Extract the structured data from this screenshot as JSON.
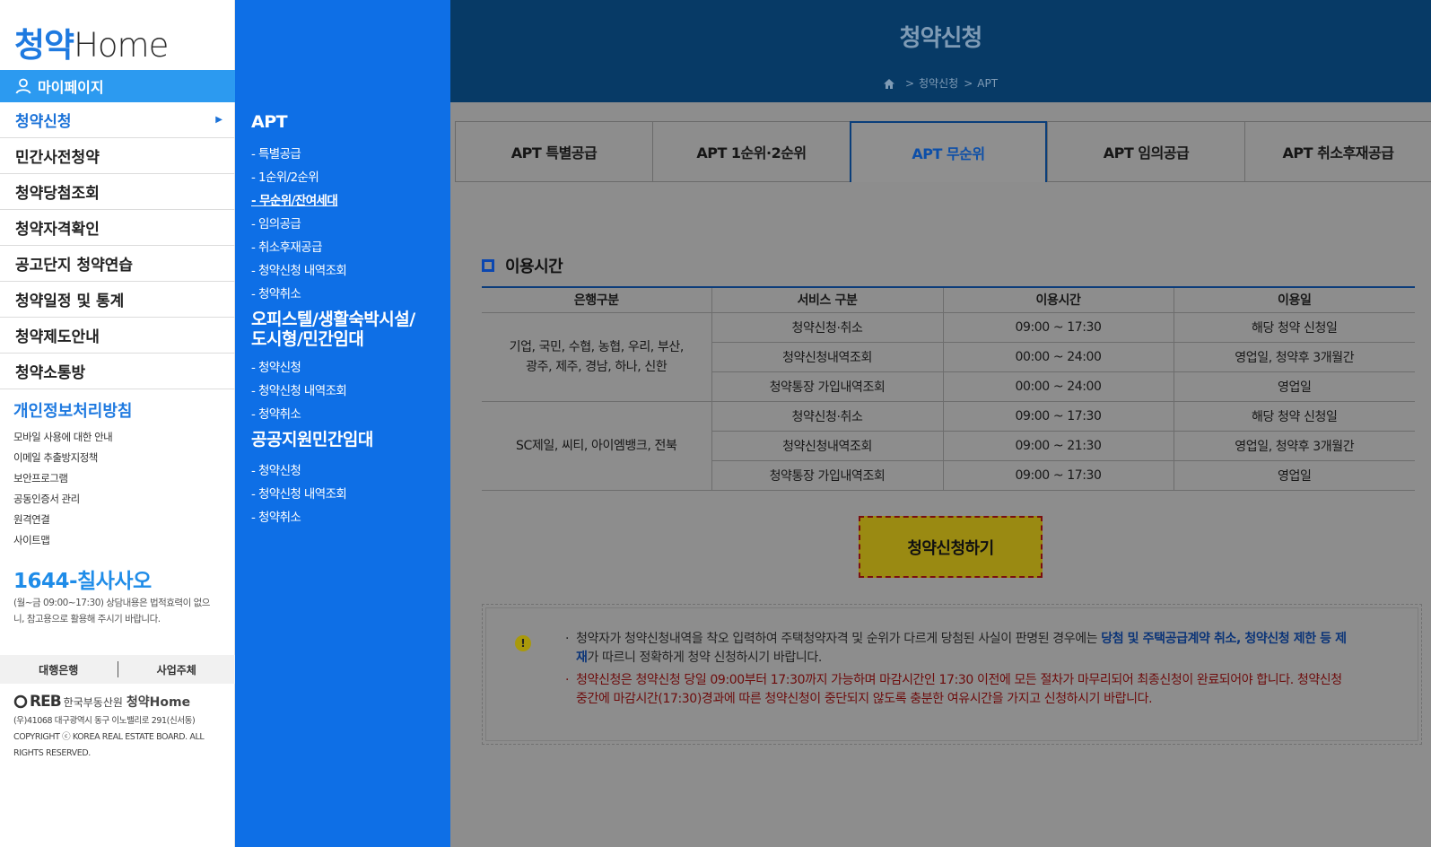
{
  "sidebar": {
    "logo": {
      "part1": "청약",
      "part2": "Home"
    },
    "mypage": "마이페이지",
    "menu": [
      {
        "label": "청약신청",
        "active": true
      },
      {
        "label": "민간사전청약"
      },
      {
        "label": "청약당첨조회"
      },
      {
        "label": "청약자격확인"
      },
      {
        "label": "공고단지 청약연습"
      },
      {
        "label": "청약일정 및 통계"
      },
      {
        "label": "청약제도안내"
      },
      {
        "label": "청약소통방"
      }
    ],
    "policy": "개인정보처리방침",
    "sublinks": [
      "모바일 사용에 대한 안내",
      "이메일 추출방지정책",
      "보안프로그램",
      "공동인증서 관리",
      "원격연결",
      "사이트맵"
    ],
    "phone": "1644-칠사사오",
    "phone_note": "(월~금 09:00~17:30) 상담내용은 법적효력이 없으니, 참고용으로 활용해 주시기 바랍니다.",
    "bank_bar": {
      "left": "대행은행",
      "right": "사업주체"
    },
    "footer_logo": {
      "reb": "REB",
      "org": "한국부동산원",
      "brand": "청약Home"
    },
    "footer_address": "(우)41068 대구광역시 동구 이노밸리로 291(신서동)",
    "footer_copyright": "COPYRIGHT ⓒ KOREA REAL ESTATE BOARD. ALL RIGHTS RESERVED."
  },
  "submenu": {
    "sections": [
      {
        "title": "APT",
        "items": [
          "- 특별공급",
          "- 1순위/2순위",
          "- 무순위/잔여세대",
          "- 임의공급",
          "- 취소후재공급",
          "- 청약신청 내역조회",
          "- 청약취소"
        ]
      },
      {
        "title_line1": "오피스텔/생활숙박시설/",
        "title_line2": "도시형/민간임대",
        "items": [
          "- 청약신청",
          "- 청약신청 내역조회",
          "- 청약취소"
        ]
      },
      {
        "title": "공공지원민간임대",
        "items": [
          "- 청약신청",
          "- 청약신청 내역조회",
          "- 청약취소"
        ]
      }
    ]
  },
  "main": {
    "title": "청약신청",
    "breadcrumb": [
      "청약신청",
      "APT"
    ],
    "tabs": [
      "APT 특별공급",
      "APT 1순위·2순위",
      "APT 무순위",
      "APT 임의공급",
      "APT 취소후재공급"
    ],
    "active_tab": 2,
    "section_title": "이용시간",
    "table": {
      "headers": [
        "은행구분",
        "서비스 구분",
        "이용시간",
        "이용일"
      ],
      "groups": [
        {
          "bank_line1": "기업, 국민, 수협, 농협, 우리, 부산,",
          "bank_line2": "광주, 제주, 경남, 하나, 신한",
          "rows": [
            [
              "청약신청·취소",
              "09:00 ~ 17:30",
              "해당 청약 신청일"
            ],
            [
              "청약신청내역조회",
              "00:00 ~ 24:00",
              "영업일, 청약후 3개월간"
            ],
            [
              "청약통장 가입내역조회",
              "00:00 ~ 24:00",
              "영업일"
            ]
          ]
        },
        {
          "bank": "SC제일, 씨티, 아이엠뱅크, 전북",
          "rows": [
            [
              "청약신청·취소",
              "09:00 ~ 17:30",
              "해당 청약 신청일"
            ],
            [
              "청약신청내역조회",
              "09:00 ~ 21:30",
              "영업일, 청약후 3개월간"
            ],
            [
              "청약통장 가입내역조회",
              "09:00 ~ 17:30",
              "영업일"
            ]
          ]
        }
      ]
    },
    "apply_button": "청약신청하기",
    "notice": {
      "n1_a": "청약자가 청약신청내역을 착오 입력하여 주택청약자격 및 순위가 다르게 당첨된 사실이 판명된 경우에는 ",
      "n1_hl": "당첨 및 주택공급계약 취소, 청약신청 제한 등 제재",
      "n1_b": "가 따르니 정확하게 청약 신청하시기 바랍니다.",
      "n2": "청약신청은 청약신청 당일 09:00부터 17:30까지 가능하며 마감시간인 17:30 이전에 모든 절차가 마무리되어 최종신청이 완료되어야 합니다. 청약신청 중간에 마감시간(17:30)경과에 따른 청약신청이 중단되지 않도록 충분한 여유시간을 가지고 신청하시기 바랍니다."
    }
  },
  "colors": {
    "sidebar_accent": "#2c9af0",
    "submenu_bg": "#0e6fe6",
    "hero_bg": "#073a66",
    "overlay": "#8d8d8d",
    "button_bg": "#9a8a12"
  }
}
